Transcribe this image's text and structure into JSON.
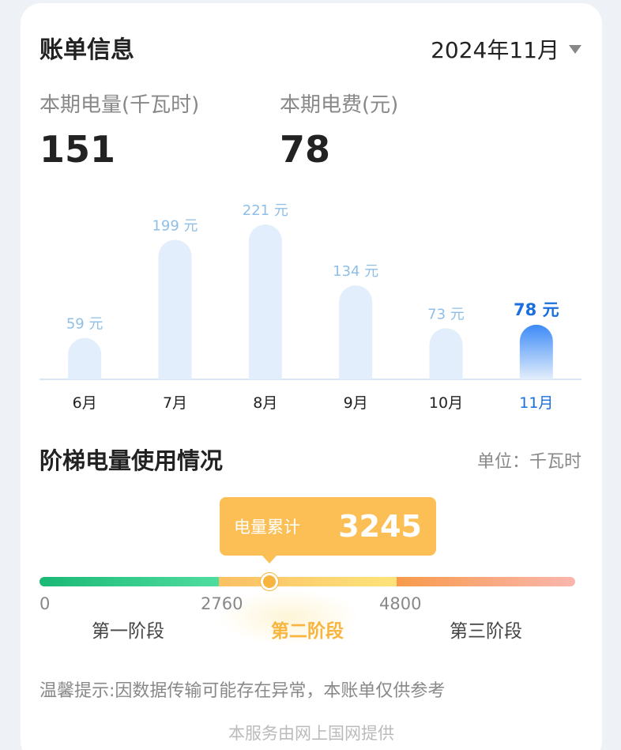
{
  "bill": {
    "title": "账单信息",
    "month": "2024年11月",
    "usage_label": "本期电量(千瓦时)",
    "usage_value": "151",
    "fee_label": "本期电费(元)",
    "fee_value": "78"
  },
  "chart_data": {
    "type": "bar",
    "categories": [
      "6月",
      "7月",
      "8月",
      "9月",
      "10月",
      "11月"
    ],
    "values": [
      59,
      199,
      221,
      134,
      73,
      78
    ],
    "value_labels": [
      "59 元",
      "199 元",
      "221 元",
      "134 元",
      "73 元",
      "78 元"
    ],
    "highlight_index": 5,
    "title": "",
    "xlabel": "",
    "ylabel": "",
    "colors": {
      "bar": "#e2eefb",
      "highlight_top": "#3d8af7",
      "highlight_bottom": "#e2eefb",
      "label": "#8fbfe6",
      "highlight_label": "#1a6fe0"
    }
  },
  "tier": {
    "title": "阶梯电量使用情况",
    "unit": "单位：千瓦时",
    "tooltip_label": "电量累计",
    "tooltip_value": "3245",
    "current": 3245,
    "ticks": [
      "0",
      "2760",
      "4800"
    ],
    "stages": [
      "第一阶段",
      "第二阶段",
      "第三阶段"
    ],
    "active_stage": 1
  },
  "notice": "温馨提示:因数据传输可能存在异常，本账单仅供参考",
  "footer": "本服务由网上国网提供"
}
